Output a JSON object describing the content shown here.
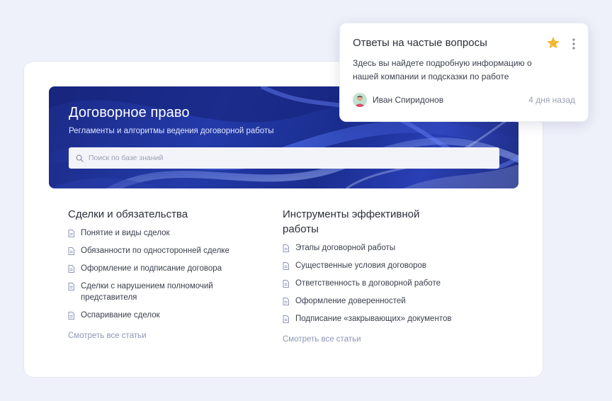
{
  "hero": {
    "title": "Договорное право",
    "subtitle": "Регламенты и алгоритмы ведения договорной работы",
    "search_placeholder": "Поиск по базе знаний"
  },
  "sections": [
    {
      "title": "Сделки и обязательства",
      "articles": [
        "Понятие и виды сделок",
        "Обязанности по односторонней сделке",
        "Оформление и подписание договора",
        "Сделки с нарушением полномочий представителя",
        "Оспаривание сделок"
      ],
      "see_all": "Смотреть все статьи"
    },
    {
      "title": "Инструменты эффективной работы",
      "articles": [
        "Этапы договорной работы",
        "Существенные условия договоров",
        "Ответственность в договорной работе",
        "Оформление доверенностей",
        "Подписание «закрывающих» документов"
      ],
      "see_all": "Смотреть все статьи"
    }
  ],
  "popup": {
    "title": "Ответы на частые вопросы",
    "description": "Здесь вы найдете подробную информацию о нашей компании и подсказки по работе",
    "author": "Иван Спиридонов",
    "time": "4 дня назад",
    "star_color": "#f5b731"
  },
  "icons": {
    "search": "search-icon",
    "document": "document-icon",
    "star": "star-icon",
    "menu": "more-vertical-icon"
  }
}
